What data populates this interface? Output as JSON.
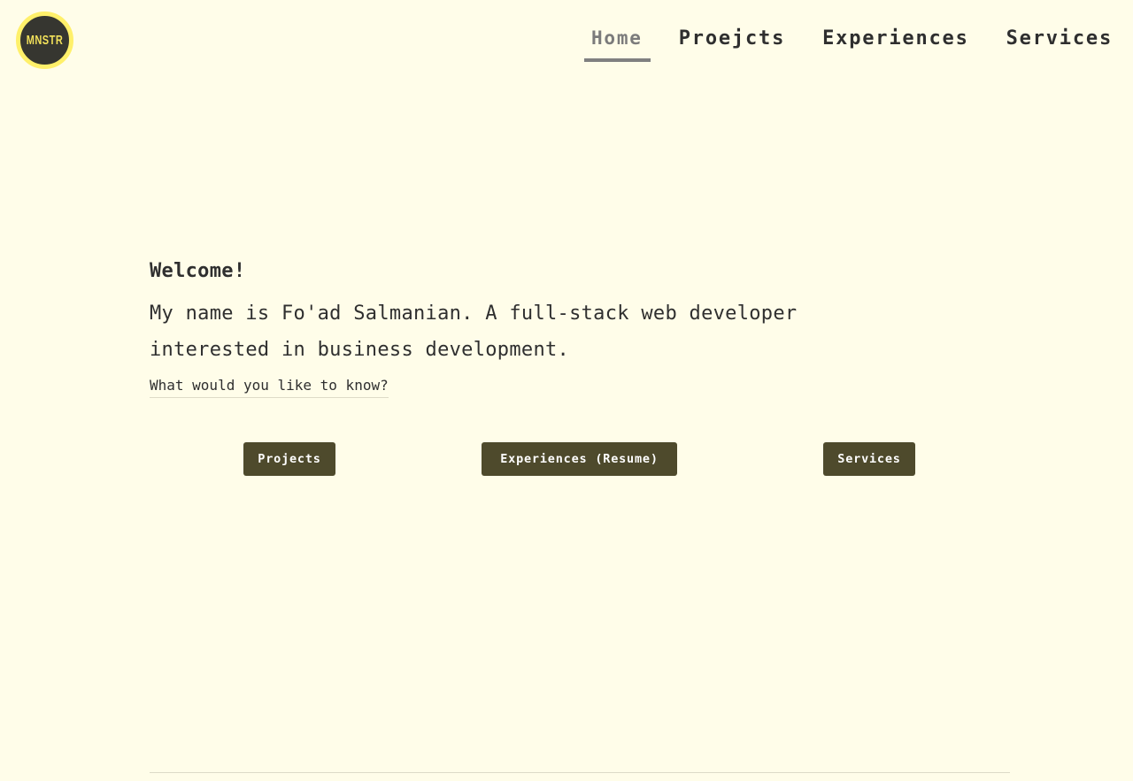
{
  "logo": {
    "text": "MNSTR"
  },
  "nav": {
    "items": [
      {
        "label": "Home",
        "active": true
      },
      {
        "label": "Proejcts",
        "active": false
      },
      {
        "label": "Experiences",
        "active": false
      },
      {
        "label": "Services",
        "active": false
      }
    ]
  },
  "intro": {
    "welcome": "Welcome!",
    "about": "My name is Fo'ad Salmanian. A full-stack web developer interested in business development.",
    "question": "What would you like to know?"
  },
  "buttons": {
    "projects": "Projects",
    "experiences": "Experiences (Resume)",
    "services": "Services"
  },
  "colors": {
    "background": "#fffde9",
    "logo_ring": "#fff06a",
    "logo_fill": "#363630",
    "button_bg": "#4e4a2c",
    "text": "#2f2f2f",
    "nav_active": "#7b7b7b"
  }
}
